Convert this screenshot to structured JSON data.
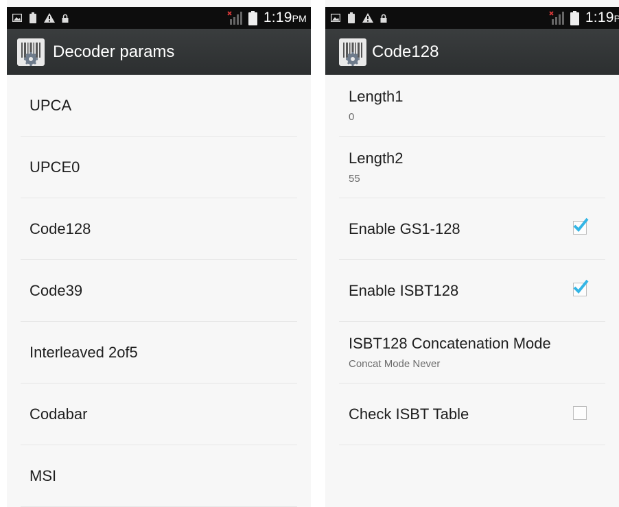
{
  "status_bar": {
    "time": "1:19",
    "ampm": "PM",
    "icons": [
      "screenshot-icon",
      "battery-saver-icon",
      "warning-icon",
      "lock-icon",
      "no-sim-signal-icon",
      "battery-icon"
    ]
  },
  "left_screen": {
    "title": "Decoder params",
    "items": [
      {
        "label": "UPCA"
      },
      {
        "label": "UPCE0"
      },
      {
        "label": "Code128"
      },
      {
        "label": "Code39"
      },
      {
        "label": "Interleaved 2of5"
      },
      {
        "label": "Codabar"
      },
      {
        "label": "MSI"
      }
    ]
  },
  "right_screen": {
    "title": "Code128",
    "prefs": [
      {
        "title": "Length1",
        "summary": "0"
      },
      {
        "title": "Length2",
        "summary": "55"
      },
      {
        "title": "Enable GS1-128",
        "checked": true
      },
      {
        "title": "Enable ISBT128",
        "checked": true
      },
      {
        "title": "ISBT128 Concatenation Mode",
        "summary": "Concat Mode Never"
      },
      {
        "title": "Check ISBT Table",
        "checked": false
      }
    ]
  },
  "colors": {
    "status_bar": "#0d0d0d",
    "action_bar": "#333637",
    "background": "#f7f7f7",
    "checkmark": "#33b5e5",
    "divider": "#e6e6e6"
  }
}
